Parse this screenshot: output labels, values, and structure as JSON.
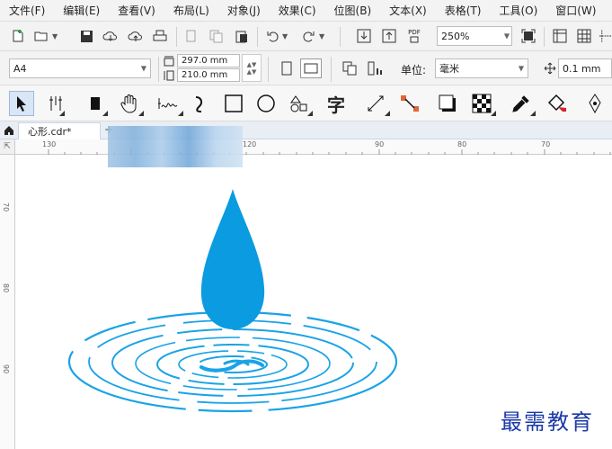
{
  "menu": [
    "文件(F)",
    "编辑(E)",
    "查看(V)",
    "布局(L)",
    "对象(J)",
    "效果(C)",
    "位图(B)",
    "文本(X)",
    "表格(T)",
    "工具(O)",
    "窗口(W)"
  ],
  "toolbar": {
    "zoom": "250%",
    "pdf_label": "PDF"
  },
  "property_bar": {
    "page_size": "A4",
    "width": "297.0 mm",
    "height": "210.0 mm",
    "unit_label": "单位:",
    "unit_value": "毫米",
    "nudge": "0.1 mm"
  },
  "toolbox": {
    "text_tool": "字"
  },
  "document_tab": "心形.cdr*",
  "ruler": {
    "h_labels": [
      "130",
      "120",
      "90",
      "80",
      "70"
    ],
    "v_labels": [
      "70",
      "80",
      "90"
    ]
  },
  "colors": {
    "drop": "#0b9be0",
    "ripple": "#1aa3e6",
    "watermark": "#1b3aa8"
  },
  "watermark": "最需教育"
}
